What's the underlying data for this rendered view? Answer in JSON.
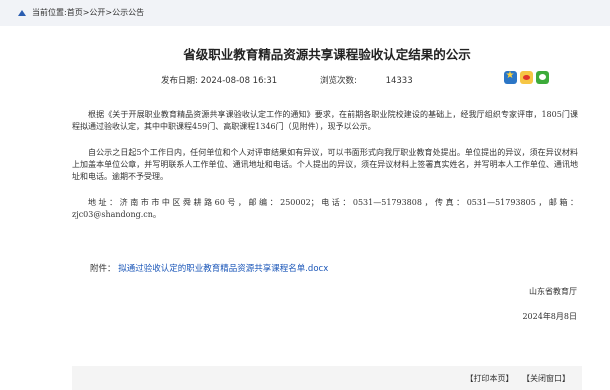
{
  "breadcrumb": {
    "prefix": "当前位置: ",
    "items": [
      "首页",
      "公开",
      "公示公告"
    ],
    "sep": " > "
  },
  "article": {
    "title": "省级职业教育精品资源共享课程验收认定结果的公示",
    "date_label": "发布日期:",
    "date_value": "2024-08-08 16:31",
    "visits_label": "浏览次数:",
    "visits_value": "14333",
    "paragraph1": "根据《关于开展职业教育精品资源共享课验收认定工作的通知》要求，在前期各职业院校建设的基础上，经我厅组织专家评审，1805门课程拟通过验收认定，其中中职课程459门、高职课程1346门（见附件），现予以公示。",
    "paragraph2": "自公示之日起5个工作日内，任何单位和个人对评审结果如有异议，可以书面形式向我厅职业教育处提出。单位提出的异议，须在异议材料上加盖本单位公章，并写明联系人工作单位、通讯地址和电话。个人提出的异议，须在异议材料上签署真实姓名，并写明本人工作单位、通讯地址和电话。逾期不予受理。",
    "paragraph3": "地址：济南市市中区舜耕路60号，邮编：250002；电话：0531—51793808，传真：0531—51793805，邮箱：zjc03@shandong.cn。",
    "attachment_label": "附件：",
    "attachment_link": "拟通过验收认定的职业教育精品资源共享课程名单.docx",
    "signature_org": "山东省教育厅",
    "signature_date": "2024年8月8日"
  },
  "share_icons": [
    "star-share-icon",
    "weibo-share-icon",
    "wechat-share-icon"
  ],
  "footer": {
    "print": "【打印本页】",
    "close": "【关闭窗口】"
  },
  "colors": {
    "link": "#1a56b8",
    "breadcrumb_bg": "#f1f3f7",
    "footer_bg": "#f4f4f4"
  }
}
